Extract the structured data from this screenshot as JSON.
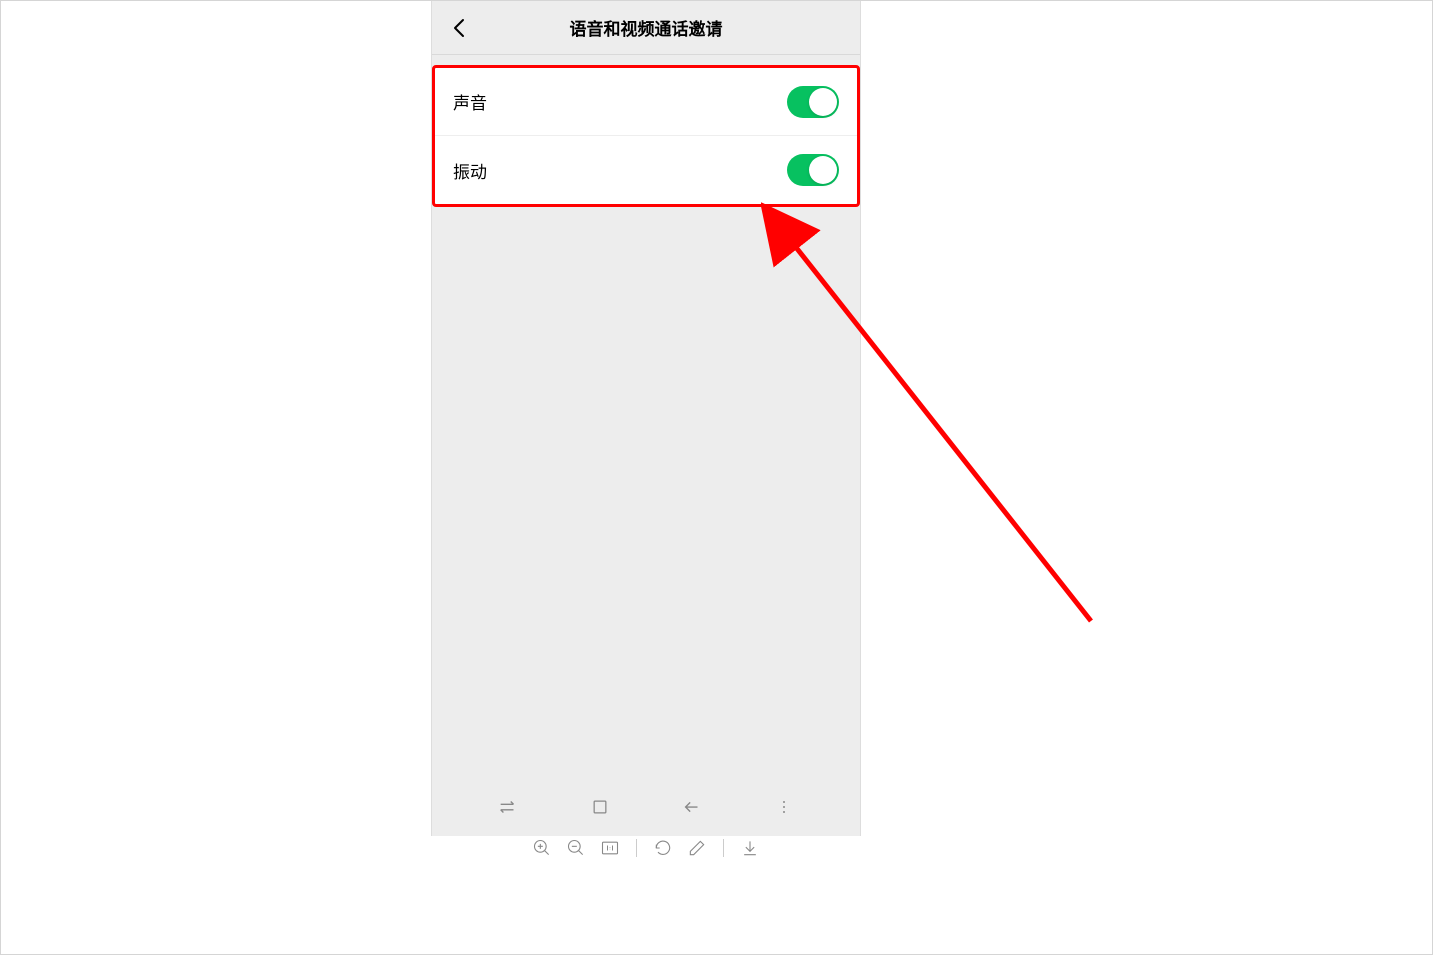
{
  "header": {
    "title": "语音和视频通话邀请"
  },
  "settings": [
    {
      "label": "声音",
      "enabled": true
    },
    {
      "label": "振动",
      "enabled": true
    }
  ],
  "colors": {
    "toggle_on": "#07c160",
    "highlight_border": "#ff0000"
  }
}
